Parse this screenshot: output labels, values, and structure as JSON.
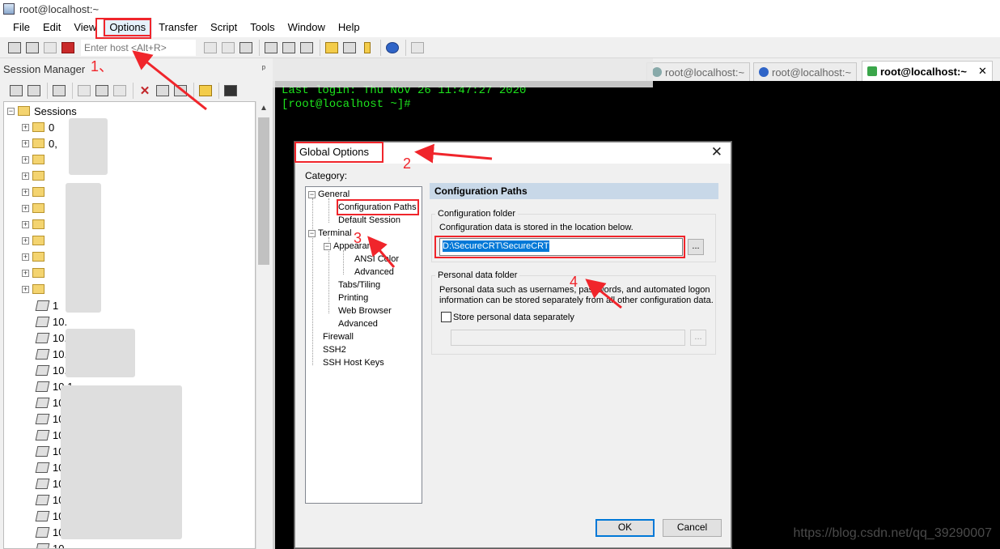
{
  "window": {
    "title": "root@localhost:~"
  },
  "menubar": [
    "File",
    "Edit",
    "View",
    "Options",
    "Transfer",
    "Script",
    "Tools",
    "Window",
    "Help"
  ],
  "toolbar": {
    "host_placeholder": "Enter host <Alt+R>"
  },
  "session_manager": {
    "title": "Session Manager",
    "pin": "ᵖ",
    "root_label": "Sessions",
    "visible_labels": [
      "0",
      "0,",
      "1",
      "10.",
      "10.1",
      "10.1",
      "10.1",
      "10.1",
      "10.1",
      "10.",
      "10",
      "10",
      "10",
      "10",
      "10",
      "10",
      "10",
      "10",
      "10.17"
    ]
  },
  "tabs": [
    {
      "label": "root@localhost:~"
    },
    {
      "label": "root@localhost:~"
    },
    {
      "label": "root@localhost:~",
      "close": "✕"
    }
  ],
  "terminal": {
    "lines": [
      "Last login: Thu Nov 26 11:47:27 2020",
      "[root@localhost ~]#"
    ]
  },
  "dialog": {
    "title": "Global Options",
    "close": "✕",
    "category_label": "Category:",
    "categories": [
      "General",
      "Configuration Paths",
      "Default Session",
      "Terminal",
      "Appearance",
      "ANSI Color",
      "Advanced",
      "Tabs/Tiling",
      "Printing",
      "Web Browser",
      "Advanced",
      "Firewall",
      "SSH2",
      "SSH Host Keys"
    ],
    "panel_title": "Configuration Paths",
    "config_folder": {
      "title": "Configuration folder",
      "description": "Configuration data is stored in the location below.",
      "path": "D:\\SecureCRT\\SecureCRT",
      "browse": "..."
    },
    "personal_folder": {
      "title": "Personal data folder",
      "description_line1": "Personal data such as usernames, passwords, and automated logon",
      "description_line2": "information can be stored separately from all other configuration data.",
      "checkbox_label": "Store personal data separately",
      "browse": "..."
    },
    "ok": "OK",
    "cancel": "Cancel"
  },
  "annotations": {
    "n1": "1、",
    "n2": "2",
    "n3": "3",
    "n4": "4",
    "color": "#f0252b"
  },
  "watermark": "https://blog.csdn.net/qq_39290007"
}
